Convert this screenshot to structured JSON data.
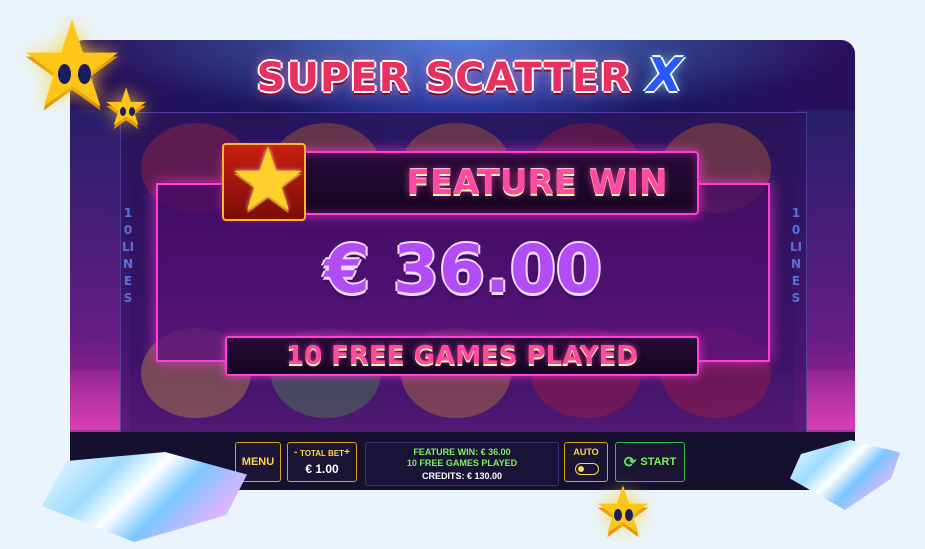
{
  "game": {
    "title_main": "SUPER SCATTER",
    "title_x": "X",
    "lines_label": "10 LINES"
  },
  "win_overlay": {
    "banner": "FEATURE WIN",
    "amount": "€ 36.00",
    "free_games": "10 FREE GAMES PLAYED"
  },
  "controls": {
    "menu_label": "MENU",
    "total_bet_label": "TOTAL BET",
    "bet_minus": "-",
    "bet_plus": "+",
    "total_bet_value": "€ 1.00",
    "info": {
      "line1": "FEATURE WIN: € 36.00",
      "line2": "10 FREE GAMES PLAYED",
      "credits": "CREDITS: € 130.00"
    },
    "auto_label": "AUTO",
    "start_label": "START"
  },
  "icons": [
    "star-icon",
    "refresh-icon",
    "diamond-icon"
  ],
  "colors": {
    "accent_pink": "#ff3fd6",
    "gold": "#ffd84a",
    "green": "#7ff05a",
    "win_purple": "#b24cf5"
  }
}
